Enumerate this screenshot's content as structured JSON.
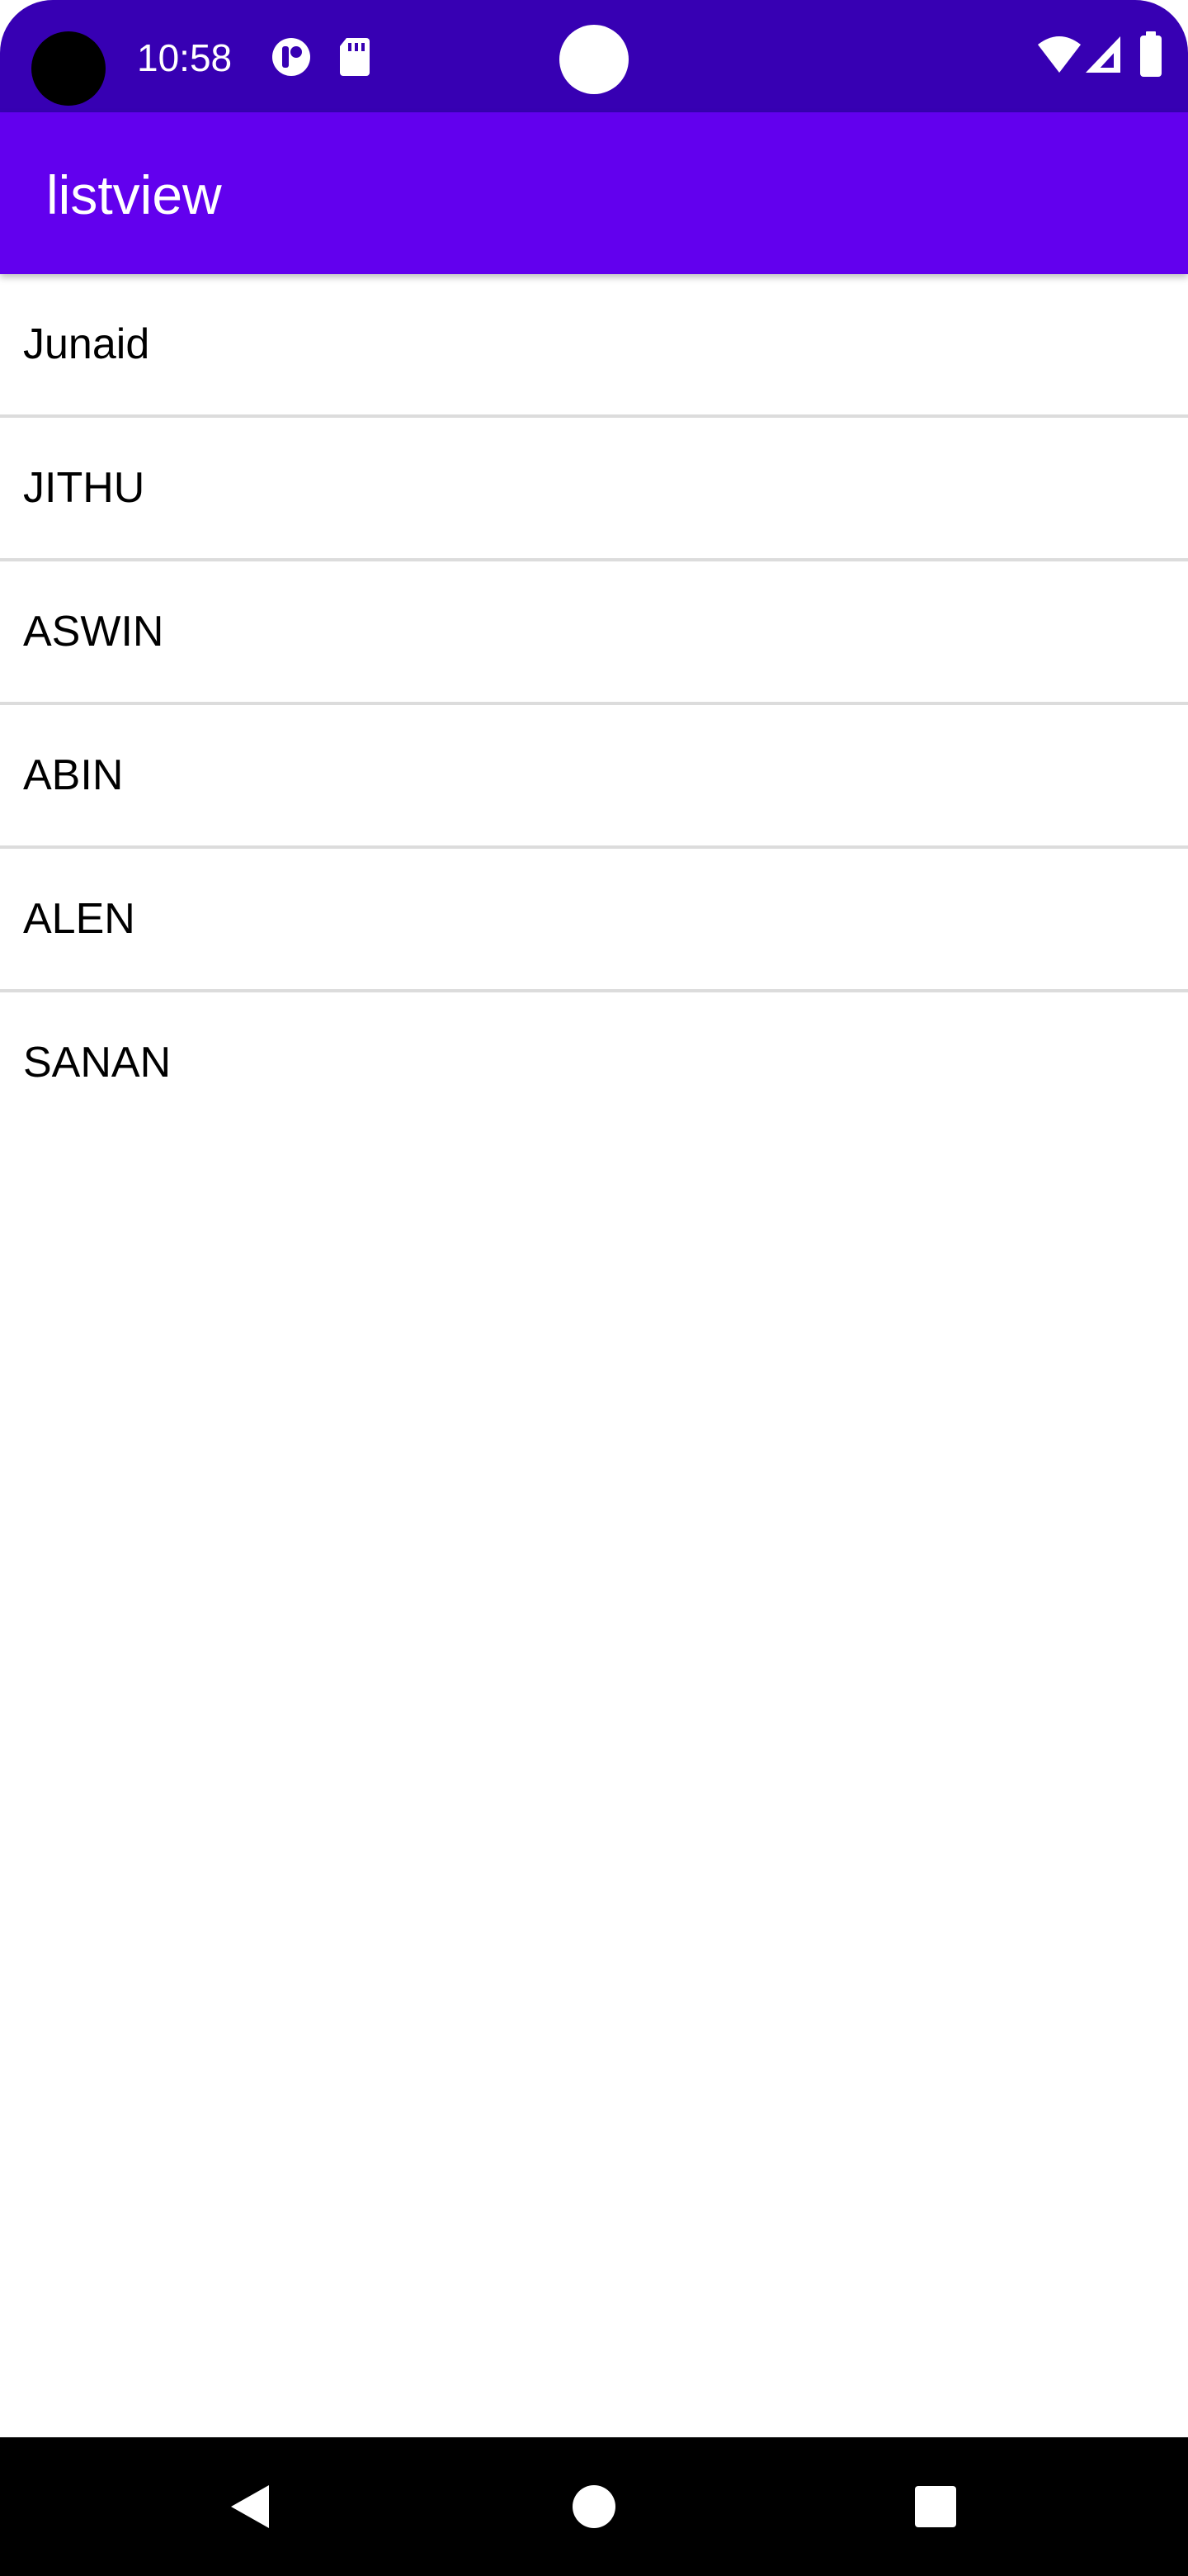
{
  "status_bar": {
    "time": "10:58",
    "icons": [
      "app-notification-icon",
      "sd-card-icon",
      "wifi-icon",
      "cell-signal-icon",
      "battery-icon"
    ]
  },
  "app_bar": {
    "title": "listview"
  },
  "list": {
    "items": [
      {
        "label": "Junaid"
      },
      {
        "label": "JITHU"
      },
      {
        "label": "ASWIN"
      },
      {
        "label": "ABIN"
      },
      {
        "label": "ALEN"
      },
      {
        "label": "SANAN"
      }
    ]
  },
  "nav_bar": {
    "buttons": [
      "back-icon",
      "home-icon",
      "recents-icon"
    ]
  },
  "colors": {
    "status_bar": "#3700b3",
    "app_bar": "#6200ee",
    "divider": "#dcdcdc",
    "nav_bar": "#000000"
  }
}
